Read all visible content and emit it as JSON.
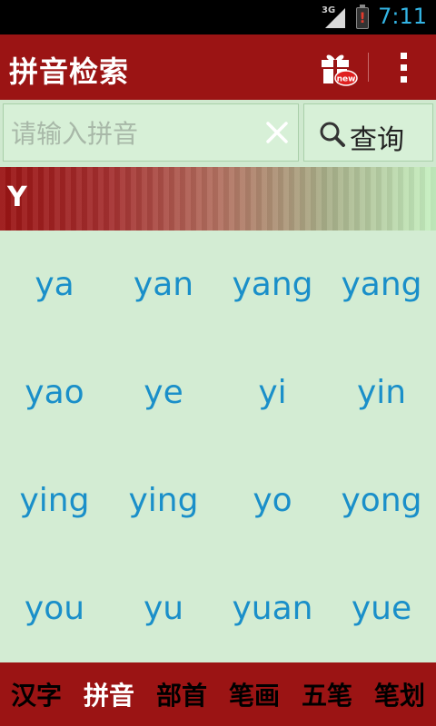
{
  "status_bar": {
    "signal_label": "3G",
    "time": "7:11"
  },
  "action_bar": {
    "title": "拼音检索",
    "gift_badge": "new"
  },
  "search": {
    "placeholder": "请输入拼音",
    "value": "",
    "button_label": "查询"
  },
  "section": {
    "letter": "Y"
  },
  "syllables": [
    "ya",
    "yan",
    "yang",
    "yang",
    "yao",
    "ye",
    "yi",
    "yin",
    "ying",
    "ying",
    "yo",
    "yong",
    "you",
    "yu",
    "yuan",
    "yue"
  ],
  "tabs": [
    {
      "label": "汉字",
      "active": false
    },
    {
      "label": "拼音",
      "active": true
    },
    {
      "label": "部首",
      "active": false
    },
    {
      "label": "笔画",
      "active": false
    },
    {
      "label": "五笔",
      "active": false
    },
    {
      "label": "笔划",
      "active": false
    }
  ],
  "colors": {
    "primary": "#9b1414",
    "content_bg": "#d3ecd3",
    "link": "#1a8fc9",
    "clock": "#33b5e5"
  }
}
